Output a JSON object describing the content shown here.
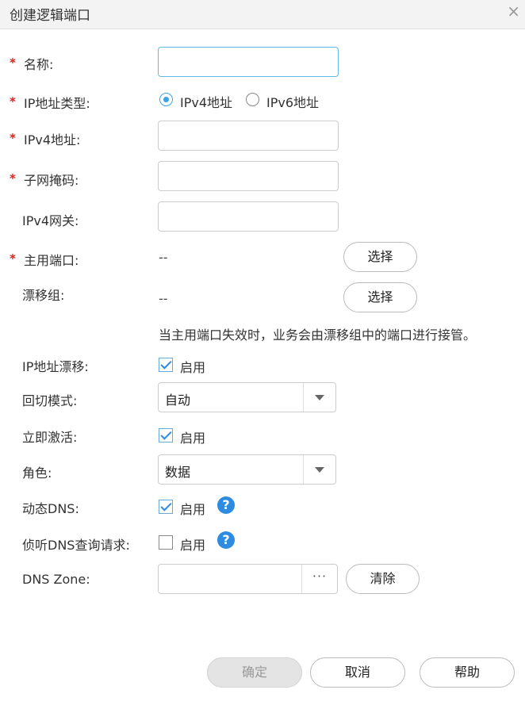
{
  "dialog": {
    "title": "创建逻辑端口",
    "close_glyph": "×"
  },
  "form": {
    "name": {
      "label": "名称:",
      "value": ""
    },
    "ip_type": {
      "label": "IP地址类型:",
      "options": [
        "IPv4地址",
        "IPv6地址"
      ],
      "selected": "IPv4地址"
    },
    "ipv4_address": {
      "label": "IPv4地址:",
      "value": ""
    },
    "subnet_mask": {
      "label": "子网掩码:",
      "value": ""
    },
    "ipv4_gateway": {
      "label": "IPv4网关:",
      "value": ""
    },
    "primary_port": {
      "label": "主用端口:",
      "value": "--",
      "button": "选择"
    },
    "failover_group": {
      "label": "漂移组:",
      "value": "--",
      "button": "选择",
      "hint": "当主用端口失效时，业务会由漂移组中的端口进行接管。"
    },
    "ip_failover": {
      "label": "IP地址漂移:",
      "checkbox_label": "启用",
      "checked": true
    },
    "failback_mode": {
      "label": "回切模式:",
      "value": "自动"
    },
    "activate_now": {
      "label": "立即激活:",
      "checkbox_label": "启用",
      "checked": true
    },
    "role": {
      "label": "角色:",
      "value": "数据"
    },
    "dynamic_dns": {
      "label": "动态DNS:",
      "checkbox_label": "启用",
      "checked": true,
      "help": "?"
    },
    "listen_dns": {
      "label": "侦听DNS查询请求:",
      "checkbox_label": "启用",
      "checked": false,
      "help": "?"
    },
    "dns_zone": {
      "label": "DNS Zone:",
      "value": "",
      "browse": "···",
      "clear_button": "清除"
    }
  },
  "footer": {
    "ok": "确定",
    "cancel": "取消",
    "help": "帮助"
  },
  "required_mark": "*",
  "colors": {
    "accent": "#3aa3e3",
    "required": "#e02020",
    "help": "#2d8be0"
  }
}
